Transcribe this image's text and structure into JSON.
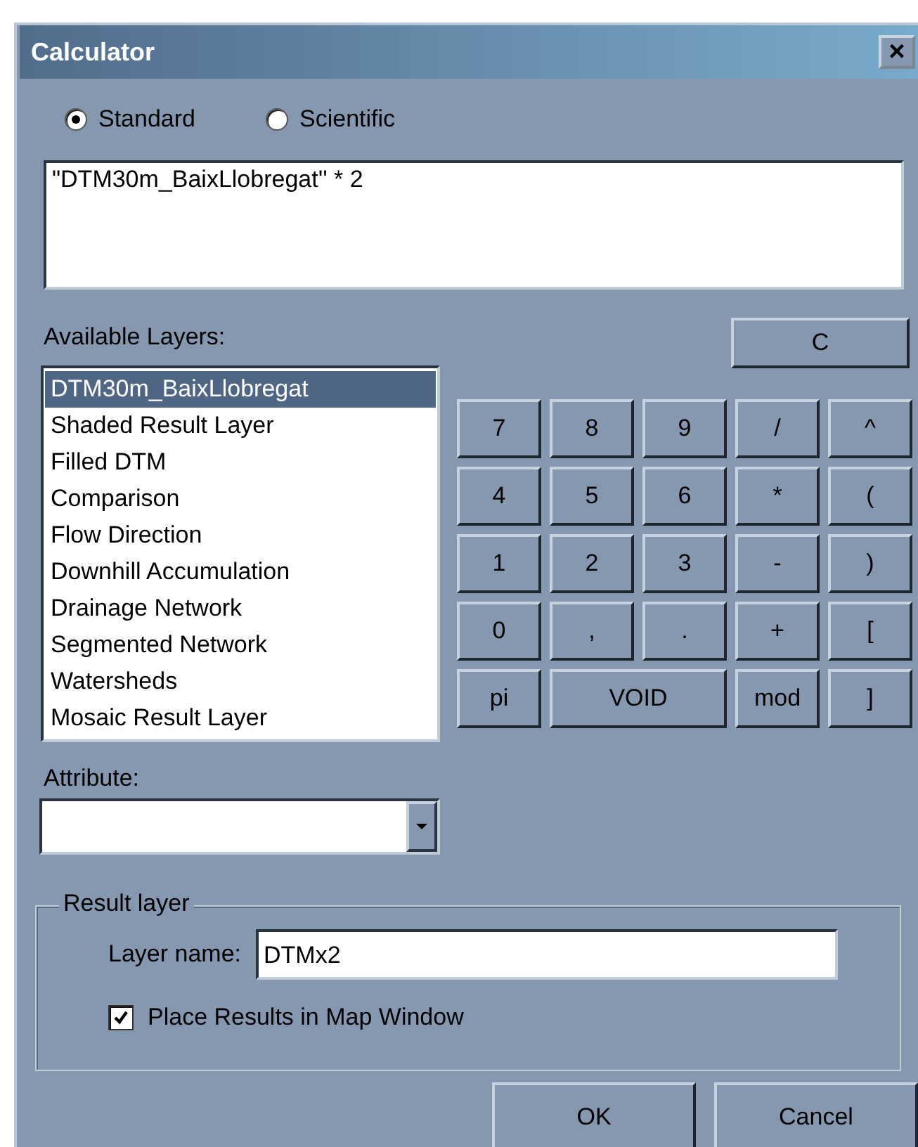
{
  "window": {
    "title": "Calculator",
    "close": "×"
  },
  "mode": [
    {
      "label": "Standard",
      "selected": true
    },
    {
      "label": "Scientific",
      "selected": false
    }
  ],
  "expression": "\"DTM30m_BaixLlobregat'' * 2",
  "layers_label": "Available Layers:",
  "clear_button": "C",
  "layers": [
    {
      "label": "DTM30m_BaixLlobregat",
      "selected": true
    },
    {
      "label": "Shaded Result Layer",
      "selected": false
    },
    {
      "label": "Filled DTM",
      "selected": false
    },
    {
      "label": "Comparison",
      "selected": false
    },
    {
      "label": "Flow Direction",
      "selected": false
    },
    {
      "label": "Downhill Accumulation",
      "selected": false
    },
    {
      "label": "Drainage Network",
      "selected": false
    },
    {
      "label": "Segmented Network",
      "selected": false
    },
    {
      "label": "Watersheds",
      "selected": false
    },
    {
      "label": "Mosaic Result Layer",
      "selected": false
    }
  ],
  "keys": [
    {
      "label": "7",
      "wide": false
    },
    {
      "label": "8",
      "wide": false
    },
    {
      "label": "9",
      "wide": false
    },
    {
      "label": "/",
      "wide": false
    },
    {
      "label": "^",
      "wide": false
    },
    {
      "label": "4",
      "wide": false
    },
    {
      "label": "5",
      "wide": false
    },
    {
      "label": "6",
      "wide": false
    },
    {
      "label": "*",
      "wide": false
    },
    {
      "label": "(",
      "wide": false
    },
    {
      "label": "1",
      "wide": false
    },
    {
      "label": "2",
      "wide": false
    },
    {
      "label": "3",
      "wide": false
    },
    {
      "label": "-",
      "wide": false
    },
    {
      "label": ")",
      "wide": false
    },
    {
      "label": "0",
      "wide": false
    },
    {
      "label": ",",
      "wide": false
    },
    {
      "label": ".",
      "wide": false
    },
    {
      "label": "+",
      "wide": false
    },
    {
      "label": "[",
      "wide": false
    },
    {
      "label": "pi",
      "wide": false
    },
    {
      "label": "VOID",
      "wide": true
    },
    {
      "label": "mod",
      "wide": false
    },
    {
      "label": "]",
      "wide": false
    }
  ],
  "attribute_label": "Attribute:",
  "result_layer": {
    "title": "Result layer",
    "name_label": "Layer name:",
    "name_value": "DTMx2",
    "place_in_map": {
      "label": "Place Results in Map Window",
      "checked": true
    }
  },
  "buttons": [
    "OK",
    "Cancel"
  ]
}
